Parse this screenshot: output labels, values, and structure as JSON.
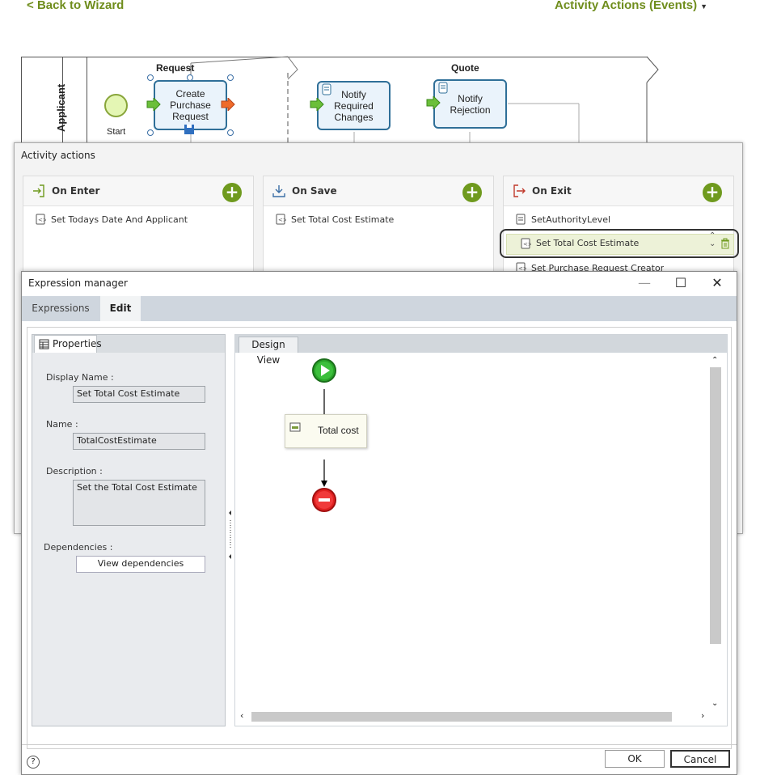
{
  "topnav": {
    "back_label": "Back to Wizard",
    "menu_label": "Activity Actions (Events)"
  },
  "process": {
    "lane_label": "Applicant",
    "stages": [
      "Request",
      "Quote"
    ],
    "start_label": "Start",
    "tasks": [
      {
        "label_lines": [
          "Create",
          "Purchase",
          "Request"
        ]
      },
      {
        "label_lines": [
          "Notify",
          "Required",
          "Changes"
        ]
      },
      {
        "label_lines": [
          "Notify",
          "Rejection"
        ]
      }
    ]
  },
  "activity_actions": {
    "title": "Activity actions",
    "on_enter": {
      "title": "On Enter",
      "items": [
        "Set Todays Date And Applicant"
      ]
    },
    "on_save": {
      "title": "On Save",
      "items": [
        "Set Total Cost Estimate"
      ]
    },
    "on_exit": {
      "title": "On Exit",
      "items": [
        "SetAuthorityLevel",
        "Set Total Cost Estimate",
        "Set Purchase Request Creator"
      ]
    }
  },
  "expression_manager": {
    "title": "Expression manager",
    "tabs": [
      "Expressions",
      "Edit"
    ],
    "active_tab": "Edit",
    "properties_tab": "Properties",
    "display_name_label": "Display Name :",
    "display_name_value": "Set Total Cost Estimate",
    "name_label": "Name :",
    "name_value": "TotalCostEstimate",
    "description_label": "Description :",
    "description_value": "Set the Total Cost Estimate",
    "dependencies_label": "Dependencies :",
    "view_dependencies_label": "View dependencies",
    "design_view_tab": "Design View",
    "flow_task_label": "Total cost",
    "ok_label": "OK",
    "cancel_label": "Cancel",
    "help_label": "?"
  },
  "colors": {
    "accent_green": "#6f9a1e",
    "link_green": "#6f8d1c",
    "task_border": "#2f6f98"
  }
}
